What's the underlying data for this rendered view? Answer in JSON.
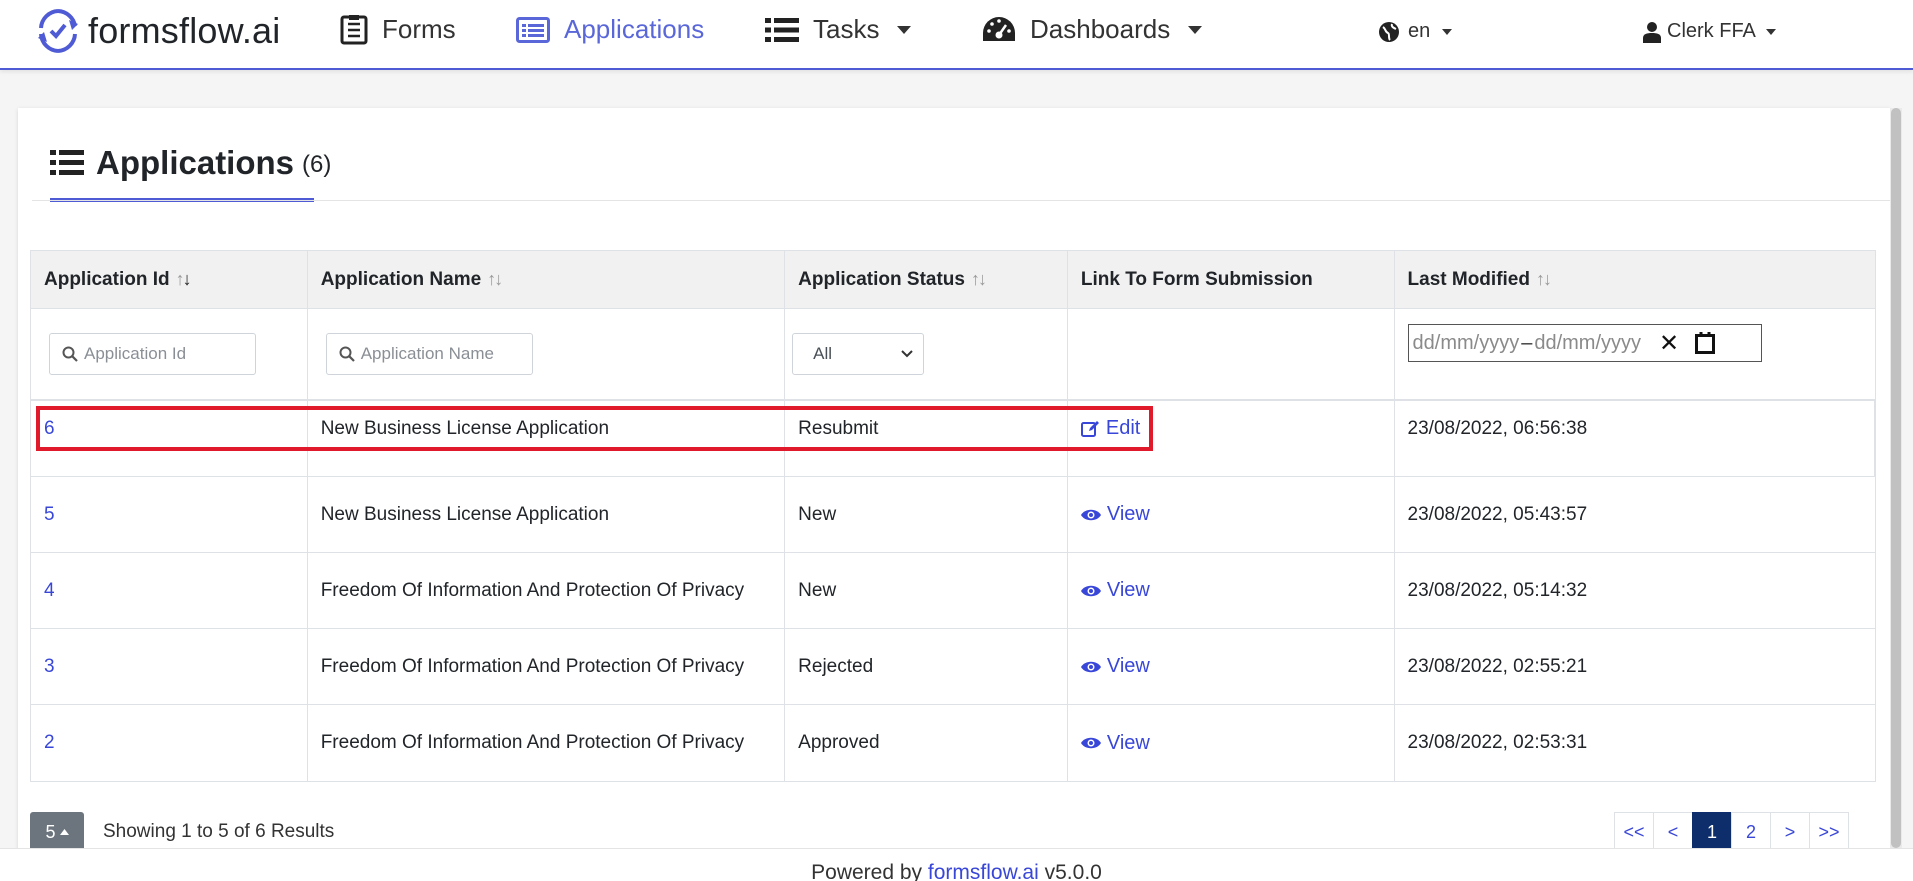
{
  "navbar": {
    "brand": "formsflow.ai",
    "items": [
      {
        "label": "Forms",
        "icon": "forms-icon",
        "active": false
      },
      {
        "label": "Applications",
        "icon": "applications-icon",
        "active": true
      },
      {
        "label": "Tasks",
        "icon": "tasks-icon",
        "active": false
      },
      {
        "label": "Dashboards",
        "icon": "dashboard-icon",
        "active": false
      }
    ],
    "language": "en",
    "user": "Clerk FFA",
    "accent_color": "#4f5bd5"
  },
  "page": {
    "title": "Applications",
    "count": "(6)"
  },
  "table": {
    "headers": [
      "Application Id",
      "Application Name",
      "Application Status",
      "Link To Form Submission",
      "Last Modified"
    ],
    "filters": {
      "id_placeholder": "Application Id",
      "name_placeholder": "Application Name",
      "status_value": "All",
      "date_from": "dd/mm/yyyy",
      "date_to": "dd/mm/yyyy",
      "date_separator": "–"
    },
    "rows": [
      {
        "id": "6",
        "name": "New Business License Application",
        "status": "Resubmit",
        "action": "Edit",
        "modified": "23/08/2022, 06:56:38"
      },
      {
        "id": "5",
        "name": "New Business License Application",
        "status": "New",
        "action": "View",
        "modified": "23/08/2022, 05:43:57"
      },
      {
        "id": "4",
        "name": "Freedom Of Information And Protection Of Privacy",
        "status": "New",
        "action": "View",
        "modified": "23/08/2022, 05:14:32"
      },
      {
        "id": "3",
        "name": "Freedom Of Information And Protection Of Privacy",
        "status": "Rejected",
        "action": "View",
        "modified": "23/08/2022, 02:55:21"
      },
      {
        "id": "2",
        "name": "Freedom Of Information And Protection Of Privacy",
        "status": "Approved",
        "action": "View",
        "modified": "23/08/2022, 02:53:31"
      }
    ]
  },
  "pagination": {
    "page_size": "5",
    "showing": "Showing 1 to 5 of 6 Results",
    "pages": [
      "<<",
      "<",
      "1",
      "2",
      ">",
      ">>"
    ],
    "active_page": "1"
  },
  "footer": {
    "prefix": "Powered by",
    "link": "formsflow.ai",
    "version": "v5.0.0"
  }
}
